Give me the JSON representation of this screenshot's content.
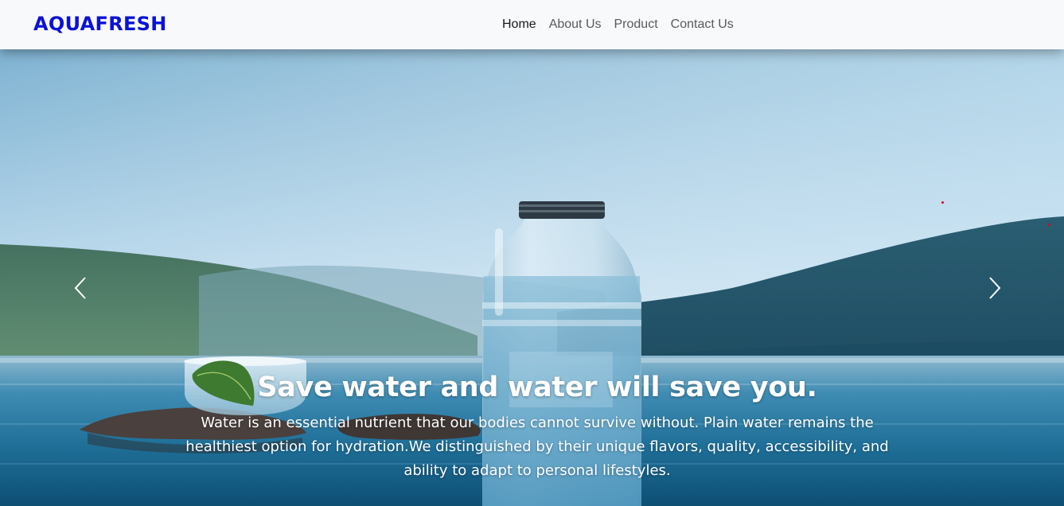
{
  "brand": {
    "name": "AQUAFRESH"
  },
  "nav": {
    "items": [
      {
        "label": "Home",
        "active": true
      },
      {
        "label": "About Us",
        "active": false
      },
      {
        "label": "Product",
        "active": false
      },
      {
        "label": "Contact Us",
        "active": false
      }
    ]
  },
  "carousel": {
    "prev_icon": "chevron-left-icon",
    "next_icon": "chevron-right-icon",
    "slide": {
      "image": "water-bottle-on-lake",
      "heading": "Save water and water will save you.",
      "text": "Water is an essential nutrient that our bodies cannot survive without. Plain water remains the healthiest option for hydration.We distinguished by their unique flavors, quality, accessibility, and ability to adapt to personal lifestyles."
    }
  },
  "colors": {
    "brand": "#0a12d6",
    "navbar_bg": "#f8f9fb",
    "nav_text": "#5a5a5a",
    "nav_active": "#1a1a1a",
    "caption_text": "#ffffff"
  }
}
